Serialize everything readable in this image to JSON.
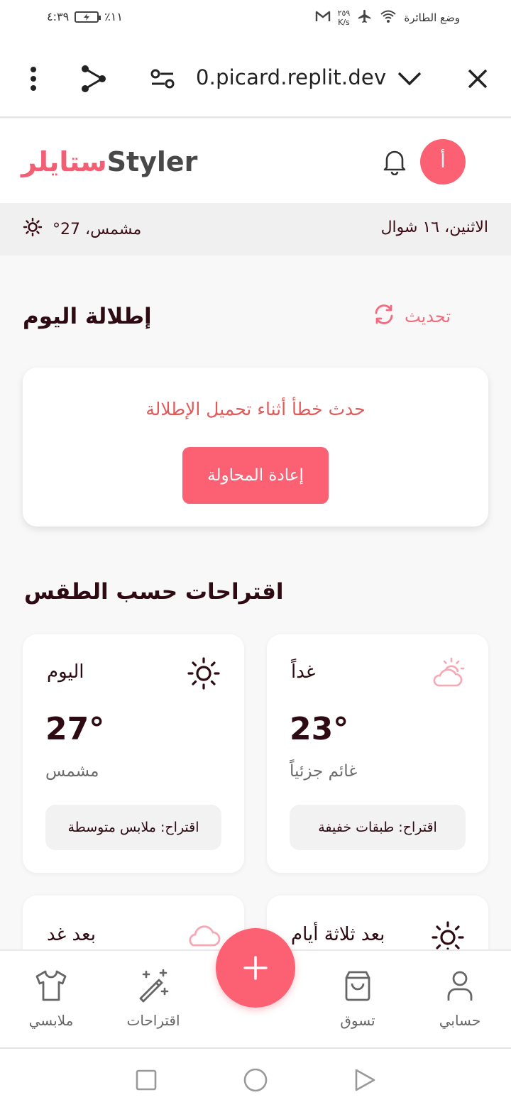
{
  "status_bar": {
    "time": "٤:٣٩",
    "battery": "٪١١",
    "network_speed_value": "٢٥٩",
    "network_speed_unit": "K/s",
    "mode": "وضع الطائرة"
  },
  "browser": {
    "url": "0.picard.replit.dev"
  },
  "header": {
    "logo_arabic": "ستايلر",
    "logo_english": "Styler",
    "avatar_letter": "أ"
  },
  "info_bar": {
    "date": "الاثنين، ١٦ شوال",
    "weather": "مشمس، 27°"
  },
  "outfit": {
    "title": "إطلالة اليوم",
    "refresh_label": "تحديث",
    "error_message": "حدث خطأ أثناء تحميل الإطلالة",
    "retry_label": "إعادة المحاولة"
  },
  "weather_section": {
    "title": "اقتراحات حسب الطقس",
    "cards": [
      {
        "day": "اليوم",
        "temp": "27°",
        "condition": "مشمس",
        "tip": "اقتراح: ملابس متوسطة",
        "icon": "sun-icon"
      },
      {
        "day": "غداً",
        "temp": "23°",
        "condition": "غائم جزئياً",
        "tip": "اقتراح: طبقات خفيفة",
        "icon": "partly-cloudy-icon"
      },
      {
        "day": "بعد غد",
        "icon": "cloud-icon"
      },
      {
        "day": "بعد ثلاثة أيام",
        "icon": "sun-icon"
      }
    ]
  },
  "bottom_nav": {
    "my_clothes": "ملابسي",
    "suggestions": "اقتراحات",
    "shopping": "تسوق",
    "account": "حسابي"
  },
  "colors": {
    "accent": "#fb6073",
    "dark_text": "#2e0a12",
    "error": "#e05a5a"
  }
}
